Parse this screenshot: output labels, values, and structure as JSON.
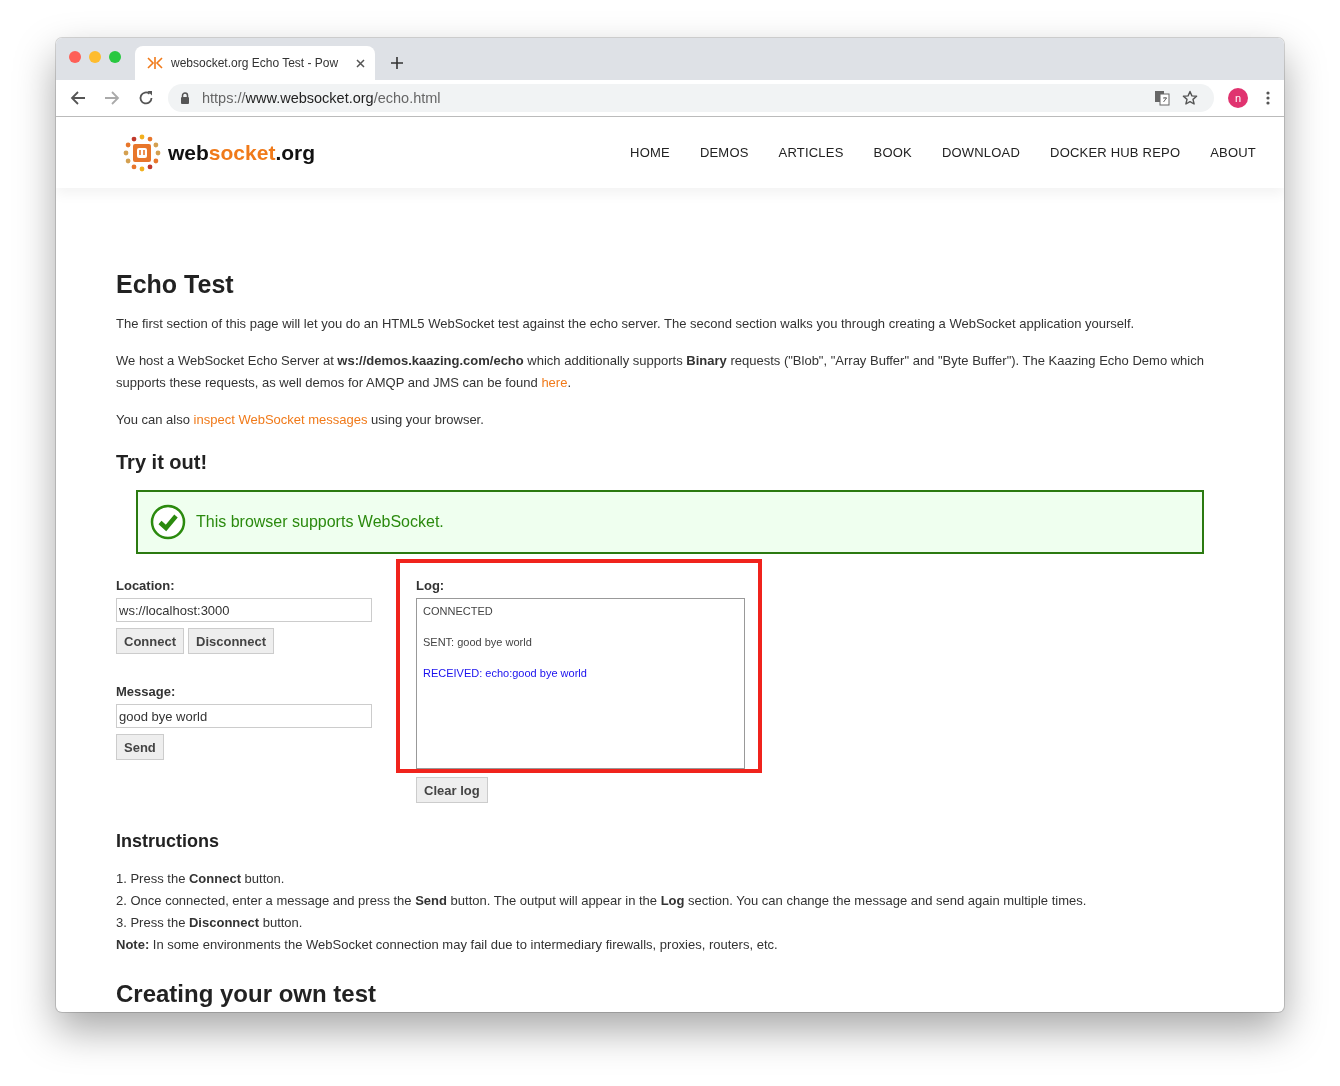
{
  "browser": {
    "tab_title": "websocket.org Echo Test - Pow",
    "address": {
      "scheme": "https://",
      "host": "www.websocket.org",
      "path": "/echo.html"
    },
    "profile_initial": "n"
  },
  "site": {
    "logo": {
      "part1": "web",
      "part2": "socket",
      "part3": ".org"
    },
    "nav": [
      {
        "label": "HOME"
      },
      {
        "label": "DEMOS"
      },
      {
        "label": "ARTICLES"
      },
      {
        "label": "BOOK"
      },
      {
        "label": "DOWNLOAD"
      },
      {
        "label": "DOCKER HUB REPO"
      },
      {
        "label": "ABOUT"
      }
    ]
  },
  "title": "Echo Test",
  "intro": [
    [
      {
        "kind": "text",
        "text": "The first section of this page will let you do an HTML5 WebSocket test against the echo server. The second section walks you through creating a WebSocket application yourself."
      }
    ],
    [
      {
        "kind": "text",
        "text": "We host a WebSocket Echo Server at **ws://demos.kaazing.com/echo** which additionally supports **Binary** requests (\"Blob\", \"Array Buffer\" and \"Byte Buffer\"). The Kaazing Echo Demo which supports these requests, as well demos for AMQP and JMS can be found "
      },
      {
        "kind": "link",
        "text": "here"
      },
      {
        "kind": "text",
        "text": "."
      }
    ],
    [
      {
        "kind": "text",
        "text": "You can also "
      },
      {
        "kind": "link",
        "text": "inspect WebSocket messages"
      },
      {
        "kind": "text",
        "text": " using your browser."
      }
    ]
  ],
  "try_heading": "Try it out!",
  "support_notice": {
    "kind": "success",
    "text": "This browser supports WebSocket."
  },
  "location": {
    "label": "Location:",
    "value": "ws://localhost:3000",
    "buttons": [
      "Connect",
      "Disconnect"
    ]
  },
  "message": {
    "label": "Message:",
    "value": "good bye world",
    "button": "Send"
  },
  "log": {
    "label": "Log:",
    "entries": [
      {
        "kind": "status",
        "text": "CONNECTED"
      },
      {
        "kind": "sent",
        "text": "SENT: good bye world"
      },
      {
        "kind": "received",
        "text": "RECEIVED: echo:good bye world"
      }
    ],
    "button": "Clear log"
  },
  "instructions": {
    "heading": "Instructions",
    "items": [
      "1. Press the **Connect** button.",
      "2. Once connected, enter a message and press the **Send** button. The output will appear in the **Log** section. You can change the message and send again multiple times.",
      "3. Press the **Disconnect** button.",
      "**Note:** In some environments the WebSocket connection may fail due to intermediary firewalls, proxies, routers, etc."
    ]
  },
  "next_heading": "Creating your own test"
}
